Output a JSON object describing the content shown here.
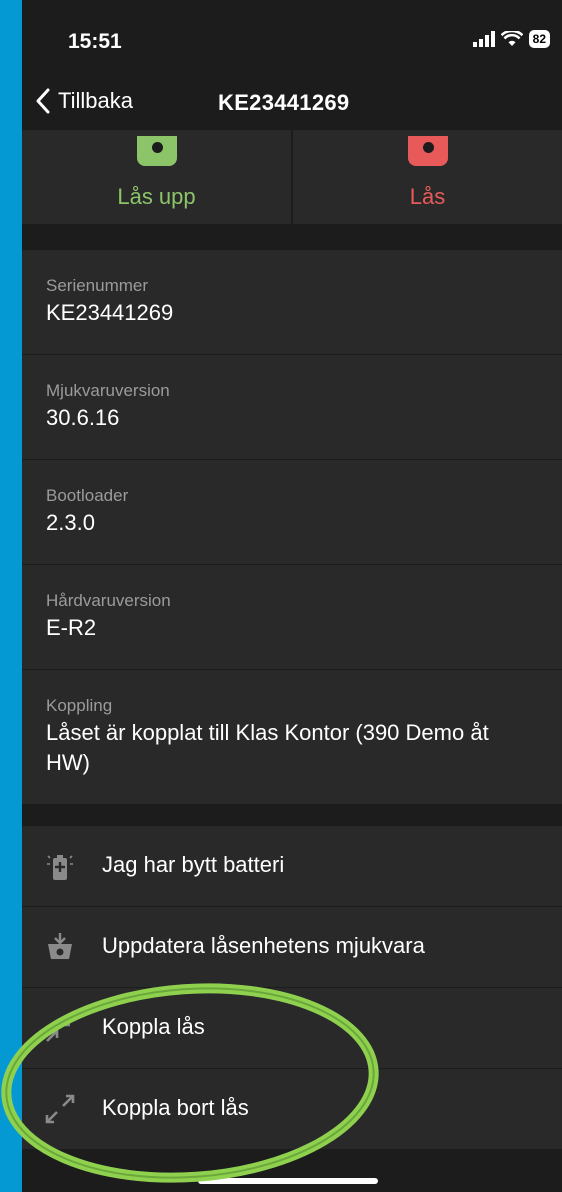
{
  "status_bar": {
    "time": "15:51",
    "battery": "82"
  },
  "nav": {
    "back_label": "Tillbaka",
    "title": "KE23441269"
  },
  "lock_controls": {
    "unlock_label": "Lås upp",
    "lock_label": "Lås",
    "unlock_color": "#8cc46a",
    "lock_color": "#e85a5a"
  },
  "info": [
    {
      "label": "Serienummer",
      "value": "KE23441269"
    },
    {
      "label": "Mjukvaruversion",
      "value": "30.6.16"
    },
    {
      "label": "Bootloader",
      "value": "2.3.0"
    },
    {
      "label": "Hårdvaruversion",
      "value": "E-R2"
    },
    {
      "label": "Koppling",
      "value": "Låset är kopplat till Klas Kontor (390 Demo åt HW)"
    }
  ],
  "actions": [
    {
      "label": "Jag har bytt batteri",
      "icon": "battery-icon"
    },
    {
      "label": "Uppdatera låsenhetens mjukvara",
      "icon": "firmware-update-icon"
    },
    {
      "label": "Koppla lås",
      "icon": "collapse-arrows-icon"
    },
    {
      "label": "Koppla bort lås",
      "icon": "expand-arrows-icon"
    }
  ],
  "colors": {
    "background": "#1c1c1c",
    "row": "#292929",
    "frame": "#0599d4",
    "highlight_ring": "#8fd14f"
  }
}
